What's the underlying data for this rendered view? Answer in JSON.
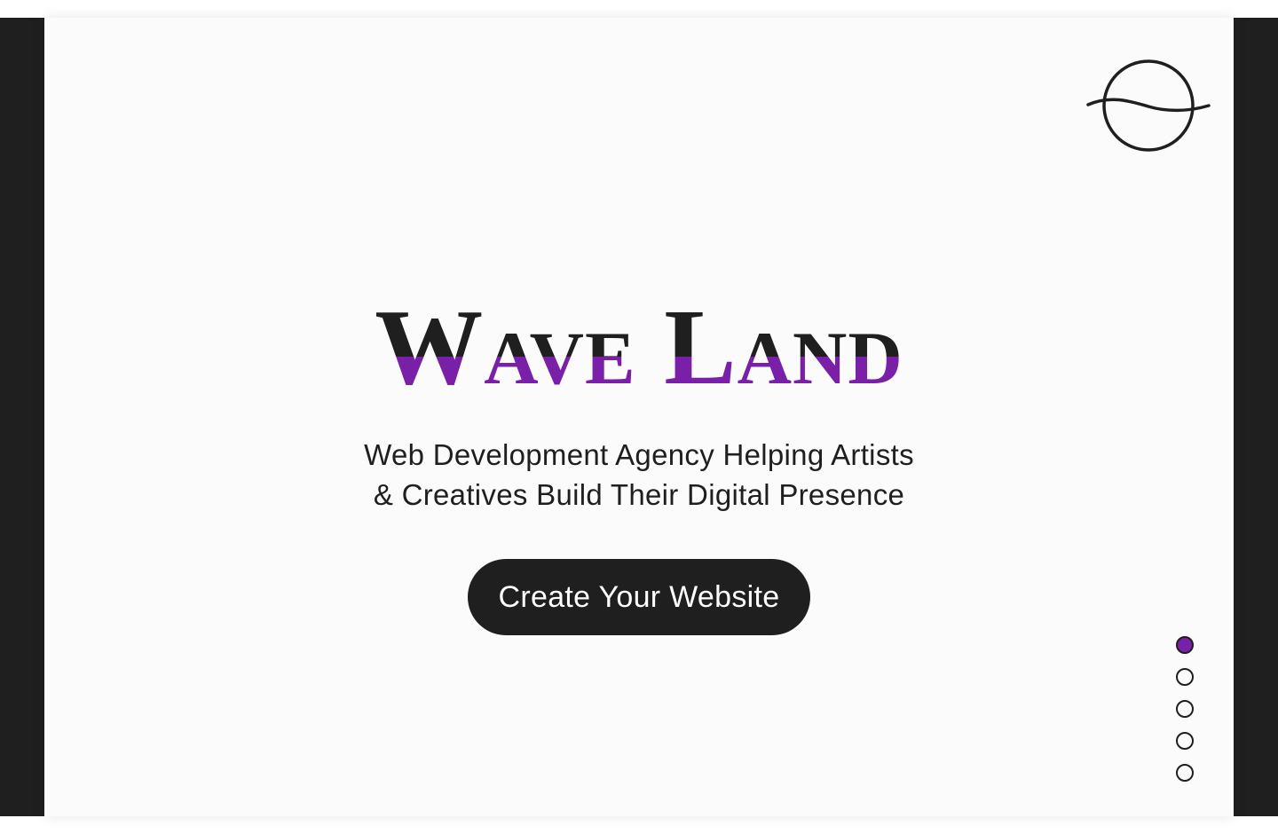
{
  "brand": {
    "title": "Wave Land",
    "logo_icon": "planet-wave-icon"
  },
  "hero": {
    "subtitle_line1": "Web Development Agency Helping Artists",
    "subtitle_line2": "& Creatives Build Their Digital Presence",
    "cta_label": "Create Your Website"
  },
  "pagination": {
    "total": 5,
    "active_index": 0
  },
  "colors": {
    "accent": "#7a1fa8",
    "dark": "#1f1f1f",
    "background": "#fbfbfb"
  }
}
